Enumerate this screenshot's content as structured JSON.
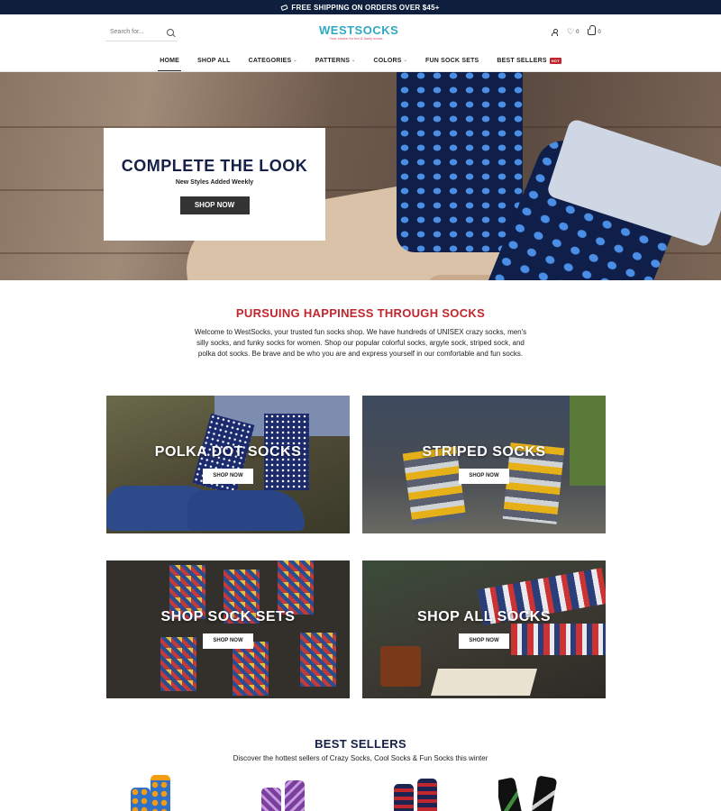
{
  "announcement": {
    "text": "FREE SHIPPING ON ORDERS OVER $45+",
    "icon": "tag-icon"
  },
  "header": {
    "search_placeholder": "Search for...",
    "logo_name": "WESTSOCKS",
    "logo_tagline": "Your choice for fun & funky socks",
    "wishlist_count": "0",
    "cart_count": "0"
  },
  "nav": {
    "items": [
      {
        "label": "HOME",
        "active": true
      },
      {
        "label": "SHOP ALL"
      },
      {
        "label": "CATEGORIES",
        "dropdown": true
      },
      {
        "label": "PATTERNS",
        "dropdown": true
      },
      {
        "label": "COLORS",
        "dropdown": true
      },
      {
        "label": "FUN SOCK SETS"
      },
      {
        "label": "BEST SELLERS",
        "badge": "HOT"
      }
    ]
  },
  "hero": {
    "title": "COMPLETE THE LOOK",
    "subtitle": "New Styles Added Weekly",
    "button": "SHOP NOW"
  },
  "intro": {
    "heading": "PURSUING HAPPINESS THROUGH SOCKS",
    "body": "Welcome to WestSocks, your trusted fun socks shop. We have hundreds of UNISEX crazy socks, men's silly socks, and funky socks for women. Shop our popular colorful socks, argyle sock, striped sock, and polka dot socks. Be brave and be who you are and express yourself in our comfortable and fun socks."
  },
  "tiles": [
    {
      "label": "POLKA DOT SOCKS",
      "button": "SHOP NOW"
    },
    {
      "label": "STRIPED SOCKS",
      "button": "SHOP NOW"
    },
    {
      "label": "SHOP SOCK SETS",
      "button": "SHOP NOW"
    },
    {
      "label": "SHOP ALL SOCKS",
      "button": "SHOP NOW"
    }
  ],
  "best_sellers": {
    "heading": "BEST SELLERS",
    "subtitle": "Discover the hottest sellers of Crazy Socks, Cool Socks & Fun Socks this winter"
  },
  "colors": {
    "navy": "#152046",
    "accent_red": "#c0262d",
    "logo_teal": "#2fa8c2",
    "announce_bg": "#0e1f3d"
  }
}
